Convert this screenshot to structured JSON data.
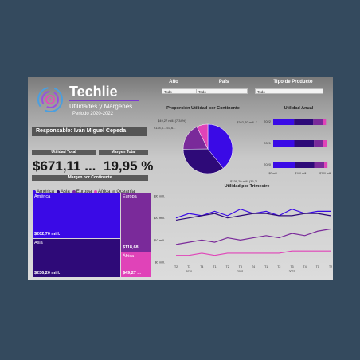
{
  "brand": {
    "name": "Techlie",
    "subtitle": "Utilidades y Márgenes",
    "period": "Periodo 2020-2022"
  },
  "responsable": "Responsable: Iván Miguel Cepeda",
  "slicers": [
    {
      "label": "Año",
      "value": "Todo"
    },
    {
      "label": "País",
      "value": "Todo"
    },
    {
      "label": "Tipo de Producto",
      "value": "Todo"
    }
  ],
  "kpis": {
    "utilidad_total": {
      "label": "Utilidad Total",
      "value": "$671,11 ..."
    },
    "margen_total": {
      "label": "Margen Total",
      "value": "19,95 %"
    }
  },
  "treemap": {
    "title": "Margen por Continente",
    "legend": [
      {
        "name": "América",
        "color": "#3a0ae6"
      },
      {
        "name": "Asia",
        "color": "#2e0a78"
      },
      {
        "name": "Europa",
        "color": "#7a2a9a"
      },
      {
        "name": "África",
        "color": "#e043b8"
      },
      {
        "name": "Oceanía",
        "color": "#8a8a8a"
      }
    ],
    "cells": [
      {
        "name": "América",
        "value": "$262,70 mill.",
        "color": "#3a0ae6"
      },
      {
        "name": "Asia",
        "value": "$236,20 mill.",
        "color": "#2e0a78"
      },
      {
        "name": "Europa",
        "value": "$118,68 ...",
        "color": "#7a2a9a"
      },
      {
        "name": "África",
        "value": "$49,27 ...",
        "color": "#e043b8"
      }
    ]
  },
  "pie": {
    "title": "Proporción Utilidad por Continente",
    "labels": [
      "$262,70 mill. (39,14%)",
      "$236,20 mill. (35,2%)",
      "$49,27 mill. (7,34%)",
      "$118,6... 57,6..."
    ]
  },
  "utilidad_anual": {
    "title": "Utilidad Anual",
    "years": [
      "2022",
      "2021",
      "2020"
    ],
    "ticks": [
      "$0 mill.",
      "$100 mill.",
      "$200 mill."
    ]
  },
  "trimestre": {
    "title": "Utilidad por Trimestre",
    "yticks": [
      "$30 mill.",
      "$20 mill.",
      "$10 mill.",
      "$0 mill."
    ],
    "quarters": [
      "T2",
      "T3",
      "T4",
      "T1",
      "T2",
      "T3",
      "T4",
      "T1",
      "T2",
      "T3",
      "T4",
      "T1",
      "T2"
    ],
    "years": [
      "2020",
      "2021",
      "2022",
      "2021"
    ]
  },
  "chart_data": [
    {
      "type": "pie",
      "title": "Proporción Utilidad por Continente",
      "categories": [
        "América",
        "Asia",
        "Europa",
        "África"
      ],
      "values": [
        262.7,
        236.2,
        118.68,
        49.27
      ],
      "colors": [
        "#3a0ae6",
        "#2e0a78",
        "#7a2a9a",
        "#e043b8"
      ]
    },
    {
      "type": "bar",
      "title": "Utilidad Anual",
      "categories": [
        "2022",
        "2021",
        "2020"
      ],
      "series": [
        {
          "name": "América",
          "values": [
            85,
            86,
            88
          ]
        },
        {
          "name": "Asia",
          "values": [
            78,
            80,
            79
          ]
        },
        {
          "name": "Europa",
          "values": [
            40,
            38,
            41
          ]
        },
        {
          "name": "África",
          "values": [
            12,
            14,
            13
          ]
        }
      ],
      "colors": [
        "#3a0ae6",
        "#2e0a78",
        "#7a2a9a",
        "#e043b8"
      ],
      "xlim": [
        0,
        240
      ]
    },
    {
      "type": "line",
      "title": "Utilidad por Trimestre",
      "x": [
        "T2",
        "T3",
        "T4",
        "T1",
        "T2",
        "T3",
        "T4",
        "T1",
        "T2",
        "T3",
        "T4",
        "T1",
        "T2"
      ],
      "ylim": [
        0,
        30
      ],
      "series": [
        {
          "name": "América",
          "values": [
            20,
            22,
            21,
            23,
            21,
            24,
            22,
            23,
            21,
            24,
            22,
            23,
            23
          ]
        },
        {
          "name": "Asia",
          "values": [
            19,
            20,
            21,
            22,
            20,
            21,
            22,
            22,
            21,
            21,
            22,
            22,
            21
          ]
        },
        {
          "name": "Europa",
          "values": [
            8,
            9,
            10,
            9,
            11,
            10,
            11,
            12,
            11,
            13,
            12,
            14,
            15
          ]
        },
        {
          "name": "África",
          "values": [
            3,
            3,
            4,
            3,
            4,
            4,
            4,
            4,
            4,
            5,
            5,
            5,
            5
          ]
        }
      ],
      "colors": [
        "#3a0ae6",
        "#2e0a78",
        "#7a2a9a",
        "#e043b8"
      ]
    }
  ]
}
